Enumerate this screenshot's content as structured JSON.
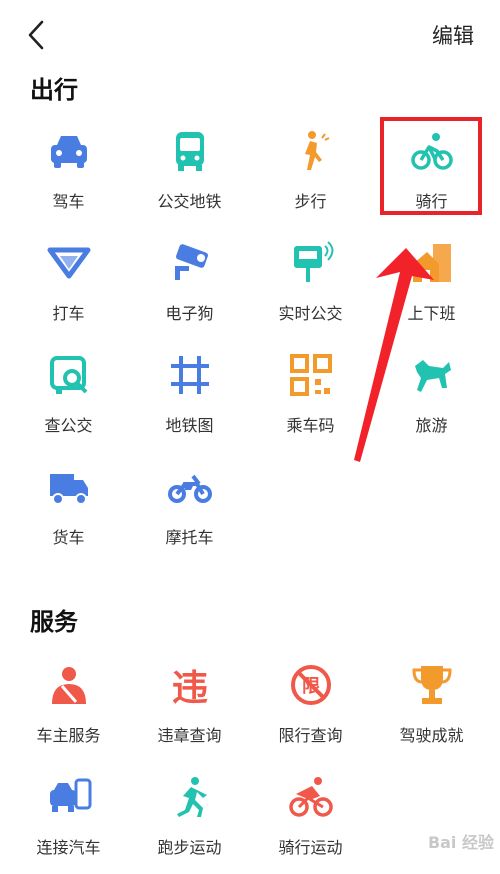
{
  "header": {
    "edit_label": "编辑"
  },
  "sections": [
    {
      "title": "出行",
      "items": [
        {
          "label": "驾车",
          "icon": "car-icon",
          "color": "#4a7de2"
        },
        {
          "label": "公交地铁",
          "icon": "bus-icon",
          "color": "#22c2b0"
        },
        {
          "label": "步行",
          "icon": "walking-icon",
          "color": "#f39a2d"
        },
        {
          "label": "骑行",
          "icon": "bicycle-icon",
          "color": "#22c2b0"
        },
        {
          "label": "打车",
          "icon": "taxi-icon",
          "color": "#4a7de2"
        },
        {
          "label": "电子狗",
          "icon": "camera-icon",
          "color": "#4a7de2"
        },
        {
          "label": "实时公交",
          "icon": "bus-stop-icon",
          "color": "#22c2b0"
        },
        {
          "label": "上下班",
          "icon": "commute-icon",
          "color": "#f39a2d"
        },
        {
          "label": "查公交",
          "icon": "bus-search-icon",
          "color": "#22c2b0"
        },
        {
          "label": "地铁图",
          "icon": "subway-map-icon",
          "color": "#4a7de2"
        },
        {
          "label": "乘车码",
          "icon": "qr-code-icon",
          "color": "#f39a2d"
        },
        {
          "label": "旅游",
          "icon": "horse-icon",
          "color": "#22c2b0"
        },
        {
          "label": "货车",
          "icon": "truck-icon",
          "color": "#4a7de2"
        },
        {
          "label": "摩托车",
          "icon": "motorcycle-icon",
          "color": "#4a7de2"
        }
      ]
    },
    {
      "title": "服务",
      "items": [
        {
          "label": "车主服务",
          "icon": "driver-icon",
          "color": "#f0584a"
        },
        {
          "label": "违章查询",
          "icon": "violation-icon",
          "color": "#f0584a"
        },
        {
          "label": "限行查询",
          "icon": "restriction-icon",
          "color": "#f0584a"
        },
        {
          "label": "驾驶成就",
          "icon": "trophy-icon",
          "color": "#f39a2d"
        },
        {
          "label": "连接汽车",
          "icon": "connect-car-icon",
          "color": "#4a7de2"
        },
        {
          "label": "跑步运动",
          "icon": "running-icon",
          "color": "#22c2b0"
        },
        {
          "label": "骑行运动",
          "icon": "cycling-sport-icon",
          "color": "#f0584a"
        }
      ]
    }
  ],
  "watermark": "Bai 经验"
}
